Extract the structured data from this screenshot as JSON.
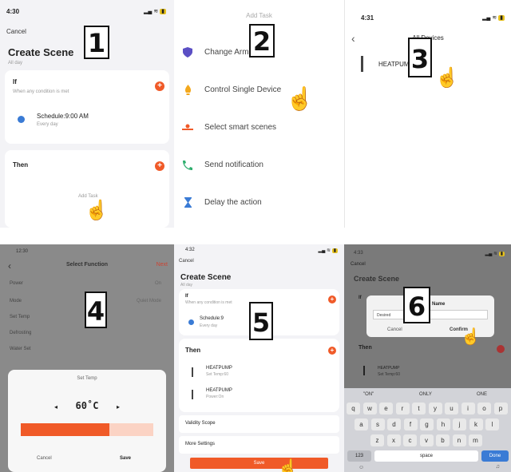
{
  "panel1": {
    "status_time": "4:30",
    "cancel_label": "Cancel",
    "title": "Create Scene",
    "subtitle": "All day",
    "if_label": "If",
    "if_hint": "When any condition is met",
    "schedule_label": "Schedule:9:00 AM",
    "schedule_sub": "Every day",
    "then_label": "Then",
    "add_task_label": "Add Task",
    "step_number": "1"
  },
  "panel2": {
    "header": "Add Task",
    "items": [
      {
        "label": "Change Arm Mode",
        "icon": "shield-icon"
      },
      {
        "label": "Control Single Device",
        "icon": "bulb-icon"
      },
      {
        "label": "Select smart scenes",
        "icon": "scene-icon"
      },
      {
        "label": "Send notification",
        "icon": "notification-icon"
      },
      {
        "label": "Delay the action",
        "icon": "hourglass-icon"
      }
    ],
    "step_number": "2"
  },
  "panel3": {
    "status_time": "4:31",
    "title": "All Devices",
    "device_label": "HEATPUMP",
    "step_number": "3"
  },
  "panel4": {
    "status_time": "12:30",
    "header": "Select Function",
    "next_label": "Next",
    "functions": [
      {
        "label": "Power",
        "value": "On"
      },
      {
        "label": "Mode",
        "value": "Quiet Mode"
      },
      {
        "label": "Set Temp",
        "value": ""
      },
      {
        "label": "Defrosting",
        "value": ""
      },
      {
        "label": "Water Set",
        "value": ""
      }
    ],
    "sheet_title": "Set Temp",
    "temp_value": "60˚C",
    "dec_label": "◂",
    "inc_label": "▸",
    "slider_fill_fraction": 0.67,
    "cancel_label": "Cancel",
    "save_label": "Save",
    "step_number": "4"
  },
  "panel5": {
    "status_time": "4:32",
    "cancel_label": "Cancel",
    "title": "Create Scene",
    "subtitle": "All day",
    "if_label": "If",
    "if_hint": "When any condition is met",
    "schedule_label": "Schedule:9",
    "schedule_sub": "Every day",
    "then_label": "Then",
    "tasks": [
      {
        "label": "HEATPUMP",
        "sub": "Set Temp:60"
      },
      {
        "label": "HEATPUMP",
        "sub": "Power:On"
      }
    ],
    "validity_label": "Validity Scope",
    "more_settings_label": "More Settings",
    "save_label": "Save",
    "step_number": "5"
  },
  "panel6": {
    "status_time": "4:33",
    "cancel_label": "Cancel",
    "title": "Create Scene",
    "if_label": "If",
    "then_label": "Then",
    "task_label": "HEATPUMP",
    "task_sub": "Set Temp:60",
    "dialog_title": "Name",
    "dialog_input": "Desired",
    "dialog_cancel": "Cancel",
    "dialog_confirm": "Confirm",
    "suggestions": [
      "\"ON\"",
      "ONLY",
      "ONE"
    ],
    "keyboard_row1": [
      "q",
      "w",
      "e",
      "r",
      "t",
      "y",
      "u",
      "i",
      "o",
      "p"
    ],
    "keyboard_row2": [
      "a",
      "s",
      "d",
      "f",
      "g",
      "h",
      "j",
      "k",
      "l"
    ],
    "keyboard_row3": [
      "z",
      "x",
      "c",
      "v",
      "b",
      "n",
      "m"
    ],
    "key_123": "123",
    "key_space": "space",
    "key_done": "Done",
    "step_number": "6"
  },
  "colors": {
    "accent": "#f05a28",
    "blue": "#3a7bd5",
    "purple": "#5b4fc4"
  }
}
